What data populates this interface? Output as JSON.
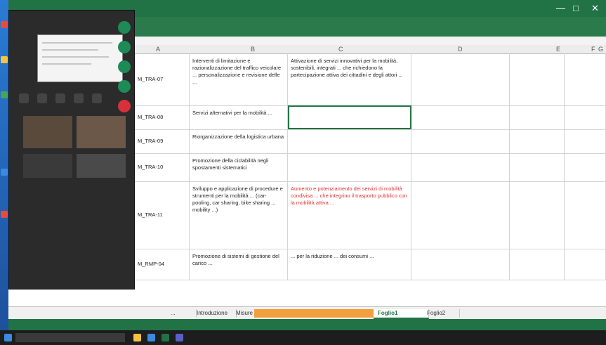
{
  "window": {
    "title": "",
    "account": "",
    "minimize": "—",
    "maximize": "□",
    "close": "✕"
  },
  "ribbon_tabs": [],
  "columns": [
    "A",
    "B",
    "C",
    "D",
    "E",
    "F",
    "G"
  ],
  "rows": [
    {
      "code": "M_TRA-07",
      "description": "Interventi di limitazione e razionalizzazione del traffico veicolare ... personalizzazione e revisione delle ...",
      "note": "Attivazione di servizi innovativi per la mobilità, sostenibili, integrati ... che richiedono la partecipazione attiva dei cittadini e degli attori ...",
      "note_red": false
    },
    {
      "code": "M_TRA-08",
      "description": "Servizi alternativi per la mobilità ...",
      "note": "",
      "note_red": false
    },
    {
      "code": "M_TRA-09",
      "description": "Riorganizzazione della logistica urbana",
      "note": "",
      "note_red": false
    },
    {
      "code": "M_TRA-10",
      "description": "Promozione della ciclabilità negli spostamenti sistematici",
      "note": "",
      "note_red": false
    },
    {
      "code": "M_TRA-11",
      "description": "Sviluppo e applicazione di procedure e strumenti per la mobilità ... (car-pooling, car sharing, bike sharing ... mobility ...)",
      "note": "Aumento e potenziamento dei servizi di mobilità condivisa ... che integrino il trasporto pubblico con la mobilità attiva ...",
      "note_red": true
    },
    {
      "code": "M_RMP-04",
      "description": "Promozione di sistemi di gestione del carico ...",
      "note": "... per la riduzione ... dei consumi ...",
      "note_red": false
    }
  ],
  "sheet_tabs": [
    {
      "label": "...",
      "style": "plain"
    },
    {
      "label": "Introduzione",
      "style": "plain"
    },
    {
      "label": "Misure",
      "style": "plain"
    },
    {
      "label": "",
      "style": "orange"
    },
    {
      "label": "",
      "style": "orange"
    },
    {
      "label": "",
      "style": "orange"
    },
    {
      "label": "Foglio1",
      "style": "active"
    },
    {
      "label": "Foglio2",
      "style": "plain"
    }
  ],
  "meeting": {
    "title": ""
  },
  "taskbar": {
    "search_placeholder": "",
    "clock": ""
  },
  "colors": {
    "excel_green": "#217346",
    "tab_orange": "#f2a03d",
    "red_text": "#e03030",
    "leave_red": "#d8303a"
  }
}
